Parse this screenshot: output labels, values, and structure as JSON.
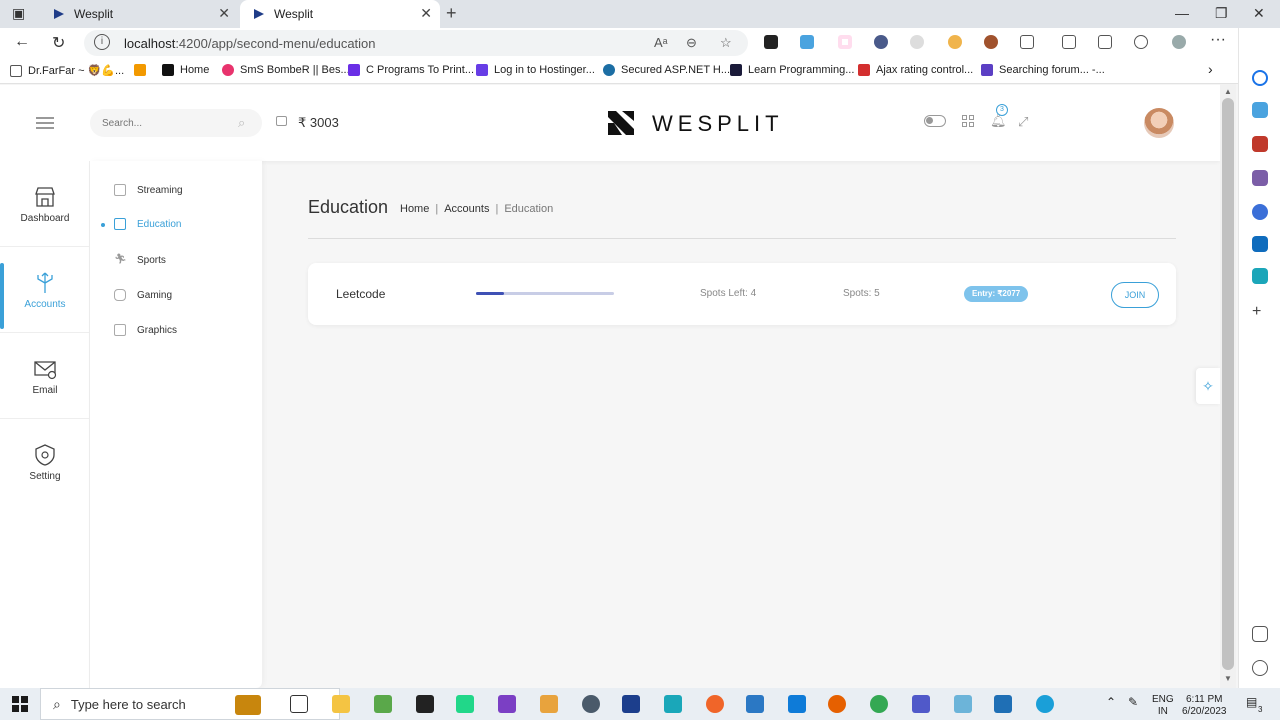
{
  "browser": {
    "tabs": [
      {
        "title": "Wesplit",
        "active": false
      },
      {
        "title": "Wesplit",
        "active": true
      }
    ],
    "url_host": "localhost",
    "url_path": ":4200/app/second-menu/education",
    "bookmarks": [
      {
        "label": "Dr.FarFar ~ 🦁💪...",
        "color": "#8b5a2b"
      },
      {
        "label": "",
        "color": "#f29900"
      },
      {
        "label": "Home",
        "color": "#111111"
      },
      {
        "label": "SmS BombeR || Bes...",
        "color": "#e8336d"
      },
      {
        "label": "C Programs To Print...",
        "color": "#6a2ee6"
      },
      {
        "label": "Log in to Hostinger...",
        "color": "#673de6"
      },
      {
        "label": "Secured ASP.NET H...",
        "color": "#1c6ea4"
      },
      {
        "label": "Learn Programming...",
        "color": "#1b1b3a"
      },
      {
        "label": "Ajax rating control...",
        "color": "#d32f2f"
      },
      {
        "label": "Searching forum... -...",
        "color": "#5b3fc4"
      }
    ]
  },
  "app": {
    "search_placeholder": "Search...",
    "balance": "₹ 3003",
    "brand": "WESPLIT",
    "notification_count": "3",
    "left_menu": [
      {
        "label": "Dashboard",
        "active": false
      },
      {
        "label": "Accounts",
        "active": true
      },
      {
        "label": "Email",
        "active": false
      },
      {
        "label": "Setting",
        "active": false
      }
    ],
    "sub_menu": [
      {
        "label": "Streaming",
        "active": false
      },
      {
        "label": "Education",
        "active": true
      },
      {
        "label": "Sports",
        "active": false
      },
      {
        "label": "Gaming",
        "active": false
      },
      {
        "label": "Graphics",
        "active": false
      }
    ],
    "page_title": "Education",
    "breadcrumb": [
      "Home",
      "Accounts",
      "Education"
    ],
    "cards": [
      {
        "name": "Leetcode",
        "progress": 0.2,
        "spots_left": "Spots Left: 4",
        "spots": "Spots: 5",
        "entry": "Entry: ₹2077",
        "action": "JOIN"
      }
    ],
    "accent_color": "#3aa0d8"
  },
  "taskbar": {
    "search_text": "Type here to search",
    "lang_top": "ENG",
    "lang_bottom": "IN",
    "time": "6:11 PM",
    "date": "6/20/2023",
    "notifications": "3"
  }
}
